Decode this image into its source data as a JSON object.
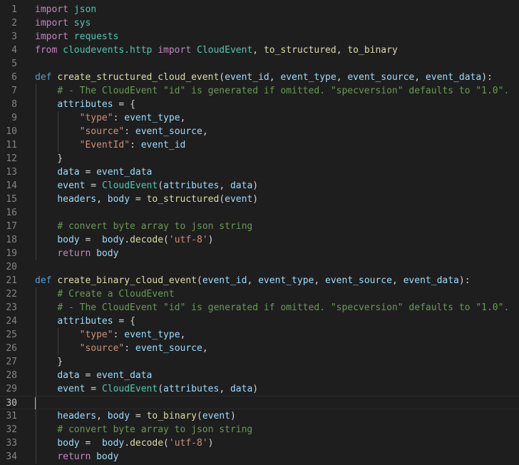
{
  "editor": {
    "language": "python",
    "current_line": 30,
    "colors": {
      "background": "#1e1e1e",
      "keyword": "#c586c0",
      "def_keyword": "#569cd6",
      "function": "#dcdcaa",
      "class": "#4ec9b0",
      "variable": "#9cdcfe",
      "string": "#ce9178",
      "comment": "#6a9955",
      "line_number": "#858585"
    },
    "lines": [
      {
        "n": "1",
        "tokens": [
          [
            "kw",
            "import"
          ],
          [
            "plain",
            " "
          ],
          [
            "mod",
            "json"
          ]
        ]
      },
      {
        "n": "2",
        "tokens": [
          [
            "kw",
            "import"
          ],
          [
            "plain",
            " "
          ],
          [
            "mod",
            "sys"
          ]
        ]
      },
      {
        "n": "3",
        "tokens": [
          [
            "kw",
            "import"
          ],
          [
            "plain",
            " "
          ],
          [
            "mod",
            "requests"
          ]
        ]
      },
      {
        "n": "4",
        "tokens": [
          [
            "kw",
            "from"
          ],
          [
            "plain",
            " "
          ],
          [
            "mod",
            "cloudevents.http"
          ],
          [
            "plain",
            " "
          ],
          [
            "kw",
            "import"
          ],
          [
            "plain",
            " "
          ],
          [
            "cls",
            "CloudEvent"
          ],
          [
            "plain",
            ", "
          ],
          [
            "fn",
            "to_structured"
          ],
          [
            "plain",
            ", "
          ],
          [
            "fn",
            "to_binary"
          ]
        ]
      },
      {
        "n": "5",
        "tokens": []
      },
      {
        "n": "6",
        "tokens": [
          [
            "def",
            "def"
          ],
          [
            "plain",
            " "
          ],
          [
            "fn",
            "create_structured_cloud_event"
          ],
          [
            "plain",
            "("
          ],
          [
            "var",
            "event_id"
          ],
          [
            "plain",
            ", "
          ],
          [
            "var",
            "event_type"
          ],
          [
            "plain",
            ", "
          ],
          [
            "var",
            "event_source"
          ],
          [
            "plain",
            ", "
          ],
          [
            "var",
            "event_data"
          ],
          [
            "plain",
            "):"
          ]
        ]
      },
      {
        "n": "7",
        "tokens": [
          [
            "plain",
            "    "
          ],
          [
            "cmt",
            "# - The CloudEvent \"id\" is generated if omitted. \"specversion\" defaults to \"1.0\"."
          ]
        ]
      },
      {
        "n": "8",
        "tokens": [
          [
            "plain",
            "    "
          ],
          [
            "var",
            "attributes"
          ],
          [
            "plain",
            " = {"
          ]
        ]
      },
      {
        "n": "9",
        "tokens": [
          [
            "plain",
            "        "
          ],
          [
            "str",
            "\"type\""
          ],
          [
            "plain",
            ": "
          ],
          [
            "var",
            "event_type"
          ],
          [
            "plain",
            ","
          ]
        ]
      },
      {
        "n": "10",
        "tokens": [
          [
            "plain",
            "        "
          ],
          [
            "str",
            "\"source\""
          ],
          [
            "plain",
            ": "
          ],
          [
            "var",
            "event_source"
          ],
          [
            "plain",
            ","
          ]
        ]
      },
      {
        "n": "11",
        "tokens": [
          [
            "plain",
            "        "
          ],
          [
            "str",
            "\"EventId\""
          ],
          [
            "plain",
            ": "
          ],
          [
            "var",
            "event_id"
          ]
        ]
      },
      {
        "n": "12",
        "tokens": [
          [
            "plain",
            "    }"
          ]
        ]
      },
      {
        "n": "13",
        "tokens": [
          [
            "plain",
            "    "
          ],
          [
            "var",
            "data"
          ],
          [
            "plain",
            " = "
          ],
          [
            "var",
            "event_data"
          ]
        ]
      },
      {
        "n": "14",
        "tokens": [
          [
            "plain",
            "    "
          ],
          [
            "var",
            "event"
          ],
          [
            "plain",
            " = "
          ],
          [
            "cls",
            "CloudEvent"
          ],
          [
            "plain",
            "("
          ],
          [
            "var",
            "attributes"
          ],
          [
            "plain",
            ", "
          ],
          [
            "var",
            "data"
          ],
          [
            "plain",
            ")"
          ]
        ]
      },
      {
        "n": "15",
        "tokens": [
          [
            "plain",
            "    "
          ],
          [
            "var",
            "headers"
          ],
          [
            "plain",
            ", "
          ],
          [
            "var",
            "body"
          ],
          [
            "plain",
            " = "
          ],
          [
            "fn",
            "to_structured"
          ],
          [
            "plain",
            "("
          ],
          [
            "var",
            "event"
          ],
          [
            "plain",
            ")"
          ]
        ]
      },
      {
        "n": "16",
        "tokens": []
      },
      {
        "n": "17",
        "tokens": [
          [
            "plain",
            "    "
          ],
          [
            "cmt",
            "# convert byte array to json string"
          ]
        ]
      },
      {
        "n": "18",
        "tokens": [
          [
            "plain",
            "    "
          ],
          [
            "var",
            "body"
          ],
          [
            "plain",
            " =  "
          ],
          [
            "var",
            "body"
          ],
          [
            "plain",
            "."
          ],
          [
            "fn",
            "decode"
          ],
          [
            "plain",
            "("
          ],
          [
            "str",
            "'utf-8'"
          ],
          [
            "plain",
            ")"
          ]
        ]
      },
      {
        "n": "19",
        "tokens": [
          [
            "plain",
            "    "
          ],
          [
            "kw",
            "return"
          ],
          [
            "plain",
            " "
          ],
          [
            "var",
            "body"
          ]
        ]
      },
      {
        "n": "20",
        "tokens": []
      },
      {
        "n": "21",
        "tokens": [
          [
            "def",
            "def"
          ],
          [
            "plain",
            " "
          ],
          [
            "fn",
            "create_binary_cloud_event"
          ],
          [
            "plain",
            "("
          ],
          [
            "var",
            "event_id"
          ],
          [
            "plain",
            ", "
          ],
          [
            "var",
            "event_type"
          ],
          [
            "plain",
            ", "
          ],
          [
            "var",
            "event_source"
          ],
          [
            "plain",
            ", "
          ],
          [
            "var",
            "event_data"
          ],
          [
            "plain",
            "):"
          ]
        ]
      },
      {
        "n": "22",
        "tokens": [
          [
            "plain",
            "    "
          ],
          [
            "cmt",
            "# Create a CloudEvent"
          ]
        ]
      },
      {
        "n": "23",
        "tokens": [
          [
            "plain",
            "    "
          ],
          [
            "cmt",
            "# - The CloudEvent \"id\" is generated if omitted. \"specversion\" defaults to \"1.0\"."
          ]
        ]
      },
      {
        "n": "24",
        "tokens": [
          [
            "plain",
            "    "
          ],
          [
            "var",
            "attributes"
          ],
          [
            "plain",
            " = {"
          ]
        ]
      },
      {
        "n": "25",
        "tokens": [
          [
            "plain",
            "        "
          ],
          [
            "str",
            "\"type\""
          ],
          [
            "plain",
            ": "
          ],
          [
            "var",
            "event_type"
          ],
          [
            "plain",
            ","
          ]
        ]
      },
      {
        "n": "26",
        "tokens": [
          [
            "plain",
            "        "
          ],
          [
            "str",
            "\"source\""
          ],
          [
            "plain",
            ": "
          ],
          [
            "var",
            "event_source"
          ],
          [
            "plain",
            ","
          ]
        ]
      },
      {
        "n": "27",
        "tokens": [
          [
            "plain",
            "    }"
          ]
        ]
      },
      {
        "n": "28",
        "tokens": [
          [
            "plain",
            "    "
          ],
          [
            "var",
            "data"
          ],
          [
            "plain",
            " = "
          ],
          [
            "var",
            "event_data"
          ]
        ]
      },
      {
        "n": "29",
        "tokens": [
          [
            "plain",
            "    "
          ],
          [
            "var",
            "event"
          ],
          [
            "plain",
            " = "
          ],
          [
            "cls",
            "CloudEvent"
          ],
          [
            "plain",
            "("
          ],
          [
            "var",
            "attributes"
          ],
          [
            "plain",
            ", "
          ],
          [
            "var",
            "data"
          ],
          [
            "plain",
            ")"
          ]
        ]
      },
      {
        "n": "30",
        "tokens": []
      },
      {
        "n": "31",
        "tokens": [
          [
            "plain",
            "    "
          ],
          [
            "var",
            "headers"
          ],
          [
            "plain",
            ", "
          ],
          [
            "var",
            "body"
          ],
          [
            "plain",
            " = "
          ],
          [
            "fn",
            "to_binary"
          ],
          [
            "plain",
            "("
          ],
          [
            "var",
            "event"
          ],
          [
            "plain",
            ")"
          ]
        ]
      },
      {
        "n": "32",
        "tokens": [
          [
            "plain",
            "    "
          ],
          [
            "cmt",
            "# convert byte array to json string"
          ]
        ]
      },
      {
        "n": "33",
        "tokens": [
          [
            "plain",
            "    "
          ],
          [
            "var",
            "body"
          ],
          [
            "plain",
            " =  "
          ],
          [
            "var",
            "body"
          ],
          [
            "plain",
            "."
          ],
          [
            "fn",
            "decode"
          ],
          [
            "plain",
            "("
          ],
          [
            "str",
            "'utf-8'"
          ],
          [
            "plain",
            ")"
          ]
        ]
      },
      {
        "n": "34",
        "tokens": [
          [
            "plain",
            "    "
          ],
          [
            "kw",
            "return"
          ],
          [
            "plain",
            " "
          ],
          [
            "var",
            "body"
          ]
        ]
      }
    ]
  }
}
